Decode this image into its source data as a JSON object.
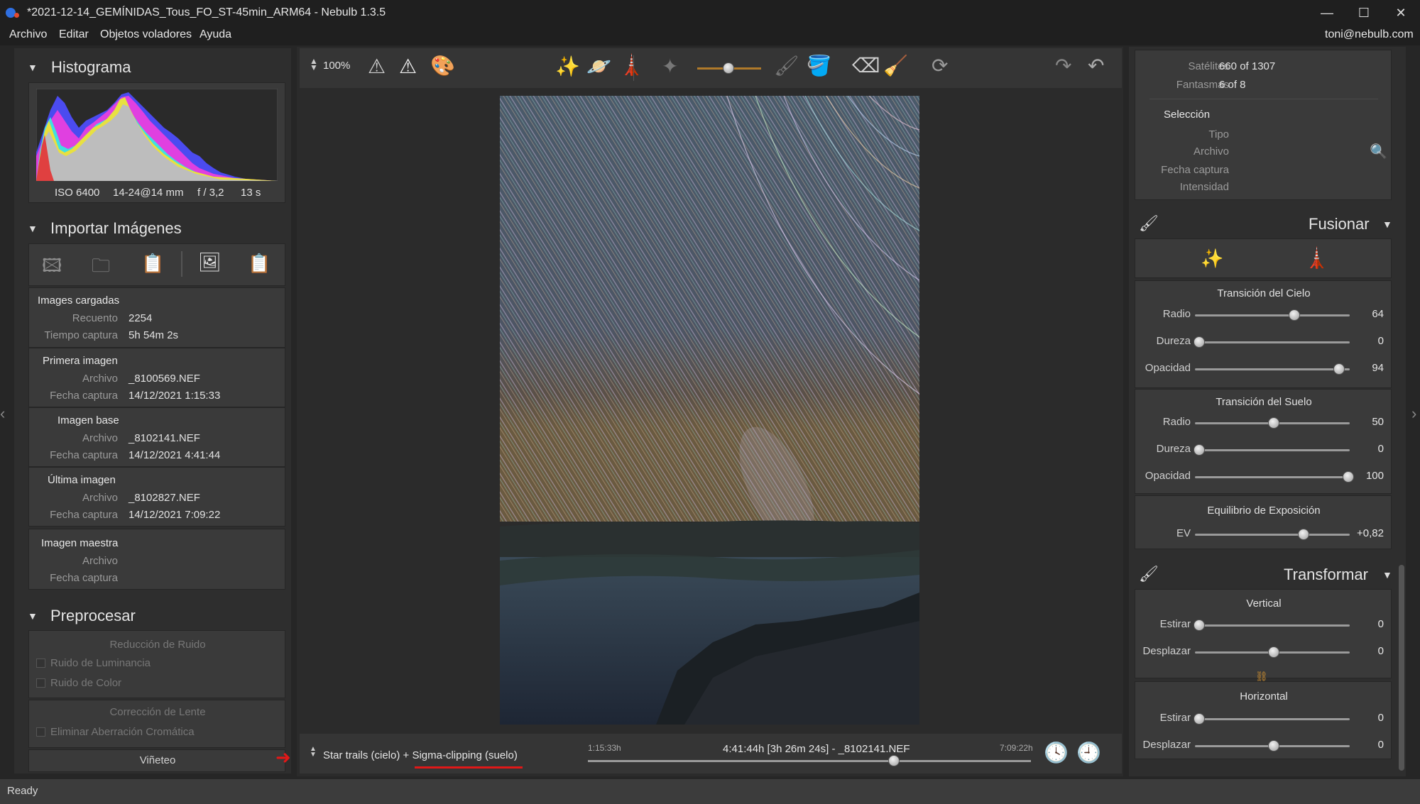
{
  "window": {
    "title": "*2021-12-14_GEMÍNIDAS_Tous_FO_ST-45min_ARM64 - Nebulb 1.3.5",
    "minimize": "—",
    "maximize": "☐",
    "close": "✕"
  },
  "menu": {
    "items": [
      "Archivo",
      "Editar",
      "Objetos voladores",
      "Ayuda"
    ],
    "user": "toni@nebulb.com"
  },
  "histogram": {
    "title": "Histograma",
    "iso": "ISO 6400",
    "lens": "14-24@14 mm",
    "aperture": "f / 3,2",
    "shutter": "13 s"
  },
  "import": {
    "title": "Importar Imágenes",
    "loaded": {
      "title": "Images cargadas",
      "count_label": "Recuento",
      "count": "2254",
      "time_label": "Tiempo captura",
      "time": "5h 54m 2s"
    },
    "first": {
      "title": "Primera imagen",
      "file_label": "Archivo",
      "file": "_8100569.NEF",
      "date_label": "Fecha captura",
      "date": "14/12/2021 1:15:33"
    },
    "base": {
      "title": "Imagen base",
      "file_label": "Archivo",
      "file": "_8102141.NEF",
      "date_label": "Fecha captura",
      "date": "14/12/2021 4:41:44"
    },
    "last": {
      "title": "Última imagen",
      "file_label": "Archivo",
      "file": "_8102827.NEF",
      "date_label": "Fecha captura",
      "date": "14/12/2021 7:09:22"
    },
    "master": {
      "title": "Imagen maestra",
      "file_label": "Archivo",
      "date_label": "Fecha captura"
    }
  },
  "preprocess": {
    "title": "Preprocesar",
    "noise_title": "Reducción de Ruido",
    "luminance": "Ruido de Luminancia",
    "color": "Ruido de Color",
    "lens_title": "Corrección de Lente",
    "aberration": "Eliminar Aberración Cromática",
    "vignette": "Viñeteo"
  },
  "toolbar": {
    "zoom": "100%"
  },
  "bottom": {
    "mode": "Star trails (cielo) + ",
    "mode_highlight": "Sigma-clipping (suelo)",
    "start_time": "1:15:33h",
    "center_label": "4:41:44h [3h 26m 24s] - _8102141.NEF",
    "end_time": "7:09:22h",
    "timeline_position": 0.69
  },
  "objects": {
    "satellites_label": "Satélites",
    "satellites": "660 of 1307",
    "ghosts_label": "Fantasmas",
    "ghosts": "6 of 8",
    "selection": "Selección",
    "type_label": "Tipo",
    "file_label": "Archivo",
    "date_label": "Fecha captura",
    "intensity_label": "Intensidad"
  },
  "fusion": {
    "title": "Fusionar",
    "sky_title": "Transición del Cielo",
    "sky": [
      {
        "label": "Radio",
        "value": "64",
        "pos": 0.64
      },
      {
        "label": "Dureza",
        "value": "0",
        "pos": 0.0
      },
      {
        "label": "Opacidad",
        "value": "94",
        "pos": 0.94
      }
    ],
    "ground_title": "Transición del Suelo",
    "ground": [
      {
        "label": "Radio",
        "value": "50",
        "pos": 0.5
      },
      {
        "label": "Dureza",
        "value": "0",
        "pos": 0.0
      },
      {
        "label": "Opacidad",
        "value": "100",
        "pos": 1.0
      }
    ],
    "exposure_title": "Equilibrio de Exposición",
    "exposure": {
      "label": "EV",
      "value": "+0,82",
      "pos": 0.7
    }
  },
  "transform": {
    "title": "Transformar",
    "vertical_title": "Vertical",
    "vertical": [
      {
        "label": "Estirar",
        "value": "0",
        "pos": 0.0
      },
      {
        "label": "Desplazar",
        "value": "0",
        "pos": 0.5
      }
    ],
    "horizontal_title": "Horizontal",
    "horizontal": [
      {
        "label": "Estirar",
        "value": "0",
        "pos": 0.0
      },
      {
        "label": "Desplazar",
        "value": "0",
        "pos": 0.5
      }
    ]
  },
  "status": {
    "text": "Ready"
  }
}
